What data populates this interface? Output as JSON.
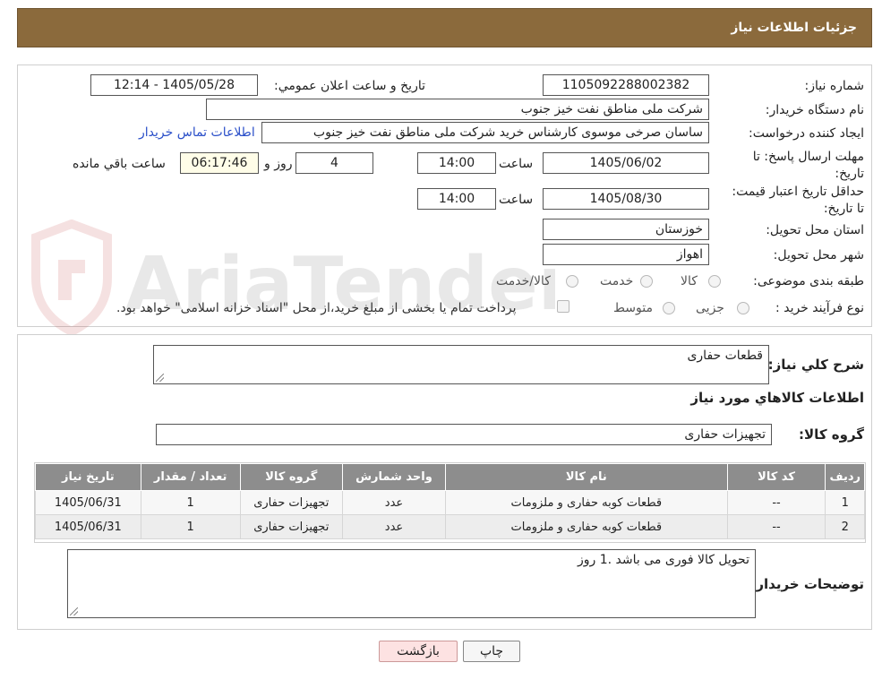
{
  "header": {
    "title": "جزئیات اطلاعات نیاز"
  },
  "form": {
    "need_number": {
      "label": "شماره نیاز:",
      "value": "1105092288002382"
    },
    "announce_datetime": {
      "label": "تاریخ و ساعت اعلان عمومي:",
      "value": "1405/05/28 - 12:14"
    },
    "buyer_org": {
      "label": "نام دستگاه خریدار:",
      "value": "شرکت ملی مناطق نفت خیز جنوب"
    },
    "requester": {
      "label": "ایجاد کننده درخواست:",
      "value": "ساسان صرخی موسوی کارشناس خرید  شرکت ملی مناطق نفت خیز جنوب",
      "contact_link": "اطلاعات تماس خریدار"
    },
    "deadline": {
      "label": "مهلت ارسال پاسخ: تا تاریخ:",
      "date": "1405/06/02",
      "time_label": "ساعت",
      "time": "14:00",
      "days": "4",
      "days_label": "روز و",
      "remaining": "06:17:46",
      "remaining_label": "ساعت باقي مانده"
    },
    "price_validity": {
      "label": "حداقل تاریخ اعتبار قیمت: تا تاریخ:",
      "date": "1405/08/30",
      "time_label": "ساعت",
      "time": "14:00"
    },
    "province": {
      "label": "استان محل تحویل:",
      "value": "خوزستان"
    },
    "city": {
      "label": "شهر محل تحویل:",
      "value": "اهواز"
    },
    "category": {
      "label": "طبقه بندی موضوعی:",
      "options": [
        "کالا",
        "خدمت",
        "کالا/خدمت"
      ]
    },
    "process": {
      "label": "نوع فرآیند خرید :",
      "options": [
        "جزیی",
        "متوسط"
      ],
      "payment_note": "پرداخت تمام یا بخشی از مبلغ خرید،از محل \"اسناد خزانه اسلامی\" خواهد بود."
    }
  },
  "details": {
    "summary_label": "شرح کلي نياز:",
    "summary_value": "قطعات حفاری",
    "goods_info_title": "اطلاعات کالاهاي مورد نياز",
    "goods_group_label": "گروه کالا:",
    "goods_group_value": "تجهیزات حفاری",
    "table": {
      "headers": [
        "رديف",
        "کد کالا",
        "نام کالا",
        "واحد شمارش",
        "گروه کالا",
        "تعداد / مقدار",
        "تاريخ نياز"
      ],
      "rows": [
        [
          "1",
          "--",
          "قطعات کوبه حفاری و ملزومات",
          "عدد",
          "تجهیزات حفاری",
          "1",
          "1405/06/31"
        ],
        [
          "2",
          "--",
          "قطعات کوبه حفاری و ملزومات",
          "عدد",
          "تجهیزات حفاری",
          "1",
          "1405/06/31"
        ]
      ]
    },
    "buyer_notes_label": "توضیحات خریدار:",
    "buyer_notes_value": "تحویل کالا فوری می باشد .1 روز"
  },
  "buttons": {
    "print": "چاپ",
    "back": "بازگشت"
  },
  "watermark": {
    "text": "AriaTender.neT"
  },
  "colors": {
    "header_bg": "#8b6a3c",
    "table_header_bg": "#8d8d8d",
    "link": "#2a4fc9",
    "back_button_bg": "#fde2e2"
  }
}
